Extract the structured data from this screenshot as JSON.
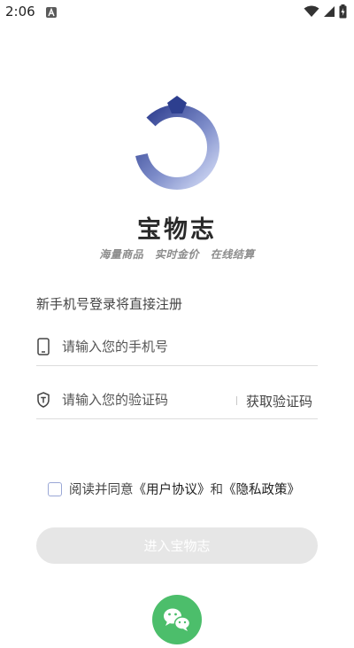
{
  "status_bar": {
    "time": "2:06",
    "notification_icon": "a-notification-icon",
    "wifi_icon": "wifi-icon",
    "signal_icon": "cell-signal-icon",
    "battery_icon": "battery-charging-icon"
  },
  "brand": {
    "name": "宝物志",
    "tagline": [
      "海量商品",
      "实时金价",
      "在线结算"
    ],
    "logo_icon": "ring-logo-icon",
    "colors": {
      "logo_dark": "#2d3f8f",
      "logo_light": "#c9d3f2"
    }
  },
  "login": {
    "hint": "新手机号登录将直接注册",
    "phone": {
      "placeholder": "请输入您的手机号",
      "value": "",
      "icon": "phone-icon"
    },
    "code": {
      "placeholder": "请输入您的验证码",
      "value": "",
      "icon": "shield-t-icon",
      "get_code_label": "获取验证码"
    },
    "agreement": {
      "prefix": "阅读并同意",
      "user_agreement": "《用户协议》",
      "and": "和",
      "privacy_policy": "《隐私政策》",
      "checked": false
    },
    "enter_button": "进入宝物志",
    "wechat_icon": "wechat-icon",
    "colors": {
      "button_disabled": "#e6e6e6",
      "wechat": "#4cbe6b"
    }
  }
}
